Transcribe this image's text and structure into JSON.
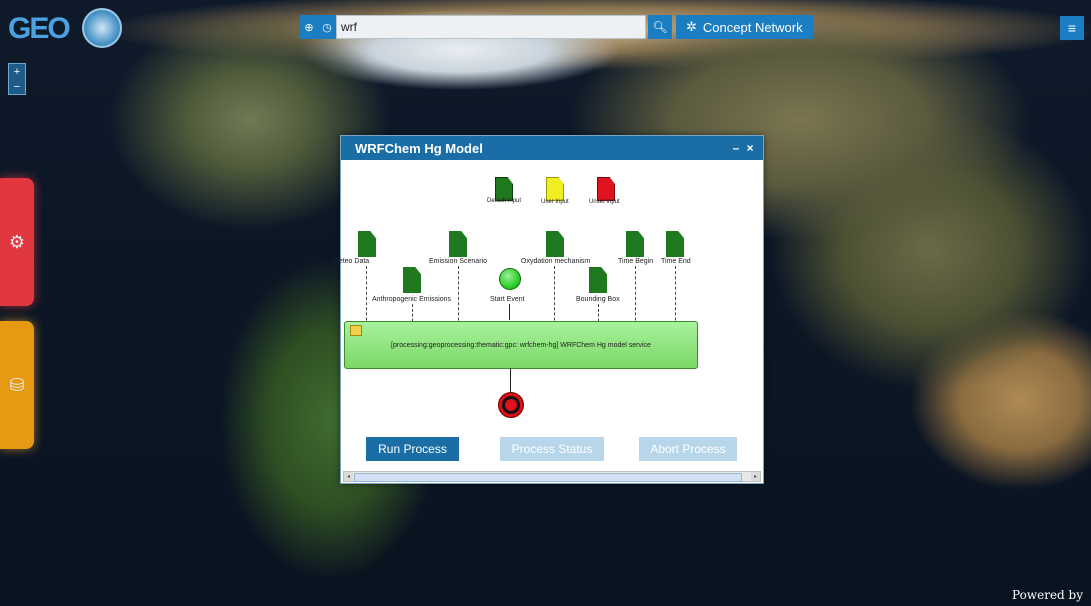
{
  "app": {
    "logo_text": "GEO"
  },
  "search": {
    "value": "wrf",
    "concept_network_label": "Concept Network"
  },
  "dialog": {
    "title": "WRFChem Hg Model",
    "minimize": "–",
    "close": "×"
  },
  "legend": {
    "items": [
      {
        "label": "Default Input",
        "color": "#1f7a1f"
      },
      {
        "label": "User Input",
        "color": "#f0ee22"
      },
      {
        "label": "Unset Input",
        "color": "#e0141e"
      }
    ]
  },
  "inputs": {
    "meteo": "Meteo Data",
    "emission": "Emission Scenario",
    "oxydation": "Oxydation mechanism",
    "time_begin": "Time Begin",
    "time_end": "Time End",
    "anthro": "Anthropogenic Emissions",
    "bbox": "Bounding Box"
  },
  "workflow": {
    "start_label": "Start Event",
    "process_text": "[processing:geoprocessing:thematic:gpc: wrfchem-hg] WRFChem Hg model service"
  },
  "buttons": {
    "run": "Run Process",
    "status": "Process Status",
    "abort": "Abort Process"
  },
  "footer": {
    "powered_by": "Powered by"
  }
}
